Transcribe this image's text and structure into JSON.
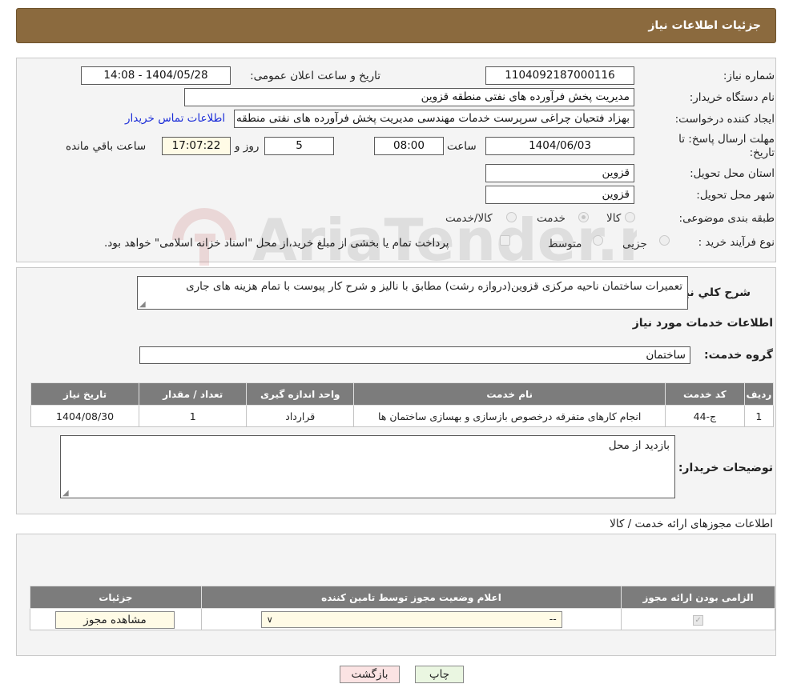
{
  "header": {
    "title": "جزئیات اطلاعات نیاز"
  },
  "form": {
    "need_number_label": "شماره نیاز:",
    "need_number": "1104092187000116",
    "announce_label": "تاریخ و ساعت اعلان عمومی:",
    "announce_value": "1404/05/28 - 14:08",
    "buyer_org_label": "نام دستگاه خریدار:",
    "buyer_org": "مدیریت پخش فرآورده های نفتی منطقه قزوین",
    "creator_label": "ایجاد کننده درخواست:",
    "creator": "بهزاد فتحیان چراغی سرپرست خدمات مهندسی مدیریت پخش فرآورده های نفتی منطقه قزوین",
    "contact_link": "اطلاعات تماس خریدار",
    "deadline_label": "مهلت ارسال پاسخ: تا تاریخ:",
    "deadline_date": "1404/06/03",
    "time_label": "ساعت",
    "deadline_time": "08:00",
    "days_value": "5",
    "days_label": "روز و",
    "remaining_time": "17:07:22",
    "remaining_label": "ساعت باقي مانده",
    "province_label": "استان محل تحویل:",
    "province": "قزوین",
    "city_label": "شهر محل تحویل:",
    "city": "قزوین",
    "category_label": "طبقه بندی موضوعی:",
    "category_options": [
      "کالا",
      "خدمت",
      "کالا/خدمت"
    ],
    "process_label": "نوع فرآیند خرید :",
    "process_options": [
      "جزیی",
      "متوسط"
    ],
    "process_note": "پرداخت تمام یا بخشی از مبلغ خرید،از محل \"اسناد خزانه اسلامی\" خواهد بود."
  },
  "summary": {
    "label": "شرح کلي نیاز:",
    "text": "تعمیرات ساختمان ناحیه مرکزی قزوین(دروازه رشت) مطابق با نالیز و شرح کار پیوست با تمام هزینه های جاری"
  },
  "services": {
    "title": "اطلاعات خدمات مورد نیاز",
    "group_label": "گروه خدمت:",
    "group_value": "ساختمان",
    "columns": [
      "ردیف",
      "کد خدمت",
      "نام خدمت",
      "واحد اندازه گیری",
      "تعداد / مقدار",
      "تاریخ نیاز"
    ],
    "rows": [
      [
        "1",
        "ج-44",
        "انجام کارهای متفرقه درخصوص بازسازی و بهسازی ساختمان ها",
        "قرارداد",
        "1",
        "1404/08/30"
      ]
    ]
  },
  "buyer_notes": {
    "label": "توضیحات خریدار:",
    "text": "بازدید از محل"
  },
  "permits": {
    "title": "اطلاعات مجوزهای ارائه خدمت / کالا",
    "columns": [
      "الزامی بودن ارائه مجوز",
      "اعلام وضعیت مجوز توسط تامین کننده",
      "جزئیات"
    ],
    "select_value": "--",
    "view_button": "مشاهده مجوز"
  },
  "actions": {
    "print": "چاپ",
    "back": "بازگشت"
  },
  "watermark": "AriaTender.net",
  "colors": {
    "header_bg": "#8b6a3e",
    "table_header_bg": "#7c7c7c",
    "link": "#1a2cd8",
    "back_button_bg": "#fbe3e3",
    "print_button_bg": "#eaf6e1",
    "view_button_bg": "#fffbe6"
  }
}
